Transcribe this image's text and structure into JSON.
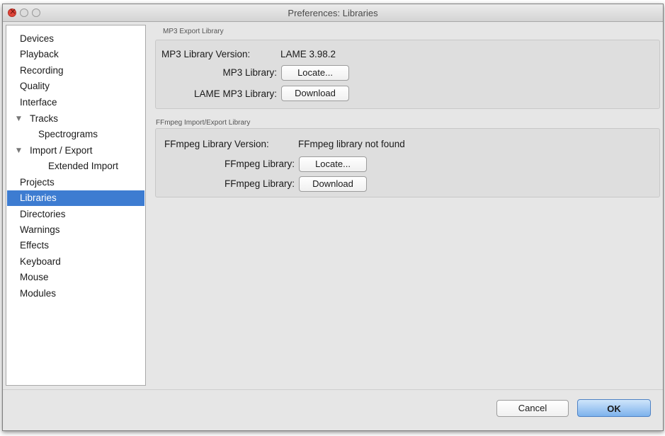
{
  "window": {
    "title": "Preferences: Libraries"
  },
  "sidebar": {
    "items": [
      {
        "label": "Devices"
      },
      {
        "label": "Playback"
      },
      {
        "label": "Recording"
      },
      {
        "label": "Quality"
      },
      {
        "label": "Interface"
      },
      {
        "label": "Tracks",
        "expanded": true
      },
      {
        "label": "Spectrograms"
      },
      {
        "label": "Import / Export",
        "expanded": true
      },
      {
        "label": "Extended Import"
      },
      {
        "label": "Projects"
      },
      {
        "label": "Libraries",
        "selected": true
      },
      {
        "label": "Directories"
      },
      {
        "label": "Warnings"
      },
      {
        "label": "Effects"
      },
      {
        "label": "Keyboard"
      },
      {
        "label": "Mouse"
      },
      {
        "label": "Modules"
      }
    ]
  },
  "mp3_group": {
    "title": "MP3 Export Library",
    "version_label": "MP3 Library Version:",
    "version_value": "LAME 3.98.2",
    "library_label": "MP3 Library:",
    "locate_button": "Locate...",
    "lame_label": "LAME MP3 Library:",
    "download_button": "Download"
  },
  "ffmpeg_group": {
    "title": "FFmpeg Import/Export Library",
    "version_label": "FFmpeg Library Version:",
    "version_value": "FFmpeg library not found",
    "library_label": "FFmpeg Library:",
    "locate_button": "Locate...",
    "download_label": "FFmpeg Library:",
    "download_button": "Download"
  },
  "footer": {
    "cancel_button": "Cancel",
    "ok_button": "OK"
  },
  "colors": {
    "selection": "#3d7cd1",
    "ok_button": "#7db2ec",
    "close_button": "#e0453a"
  }
}
